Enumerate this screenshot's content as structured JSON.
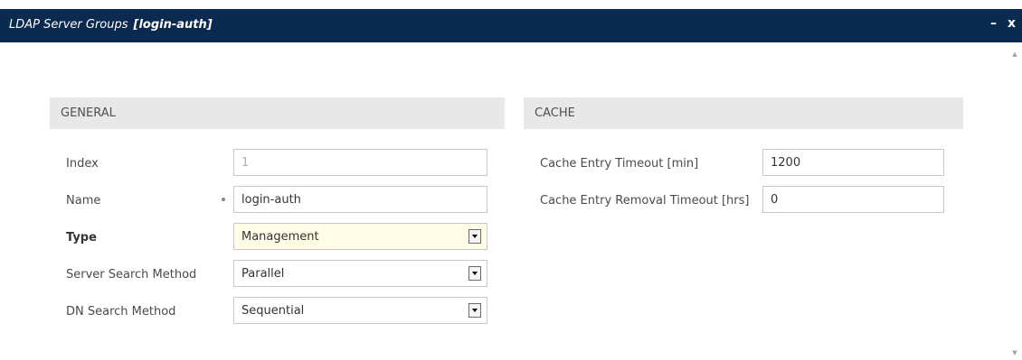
{
  "window": {
    "title": "LDAP Server Groups",
    "record_name": "[login-auth]",
    "minimize_label": "–",
    "close_label": "x",
    "scroll_up_label": "▲",
    "scroll_down_label": "▼"
  },
  "general": {
    "header": "GENERAL",
    "index": {
      "label": "Index",
      "value": "1"
    },
    "name": {
      "label": "Name",
      "value": "login-auth"
    },
    "type": {
      "label": "Type",
      "value": "Management"
    },
    "server_search_method": {
      "label": "Server Search Method",
      "value": "Parallel"
    },
    "dn_search_method": {
      "label": "DN Search Method",
      "value": "Sequential"
    }
  },
  "cache": {
    "header": "CACHE",
    "entry_timeout": {
      "label": "Cache Entry Timeout [min]",
      "value": "1200"
    },
    "removal_timeout": {
      "label": "Cache Entry Removal Timeout [hrs]",
      "value": "0"
    }
  },
  "colors": {
    "titlebar": "#0b2a50",
    "section_header": "#e8e8e8",
    "highlight_field": "#fffde6"
  }
}
